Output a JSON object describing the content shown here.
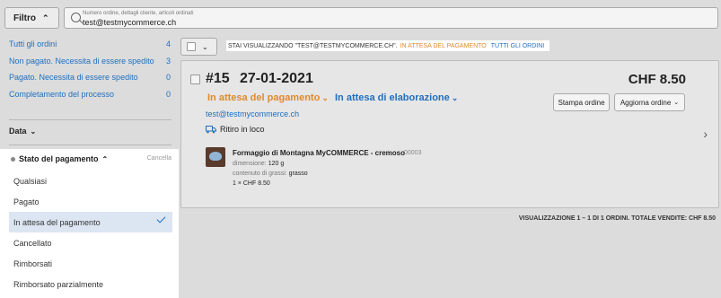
{
  "toolbar": {
    "filter_label": "Filtro"
  },
  "search": {
    "placeholder": "Numero ordine, dettagli cliente, articoli ordinati",
    "value": "test@testmycommerce.ch"
  },
  "sidebar": {
    "items": [
      {
        "label": "Tutti gli ordini",
        "count": "4"
      },
      {
        "label": "Non pagato. Necessita di essere spedito",
        "count": "3"
      },
      {
        "label": "Pagato. Necessita di essere spedito",
        "count": "0"
      },
      {
        "label": "Completamento del processo",
        "count": "0"
      }
    ],
    "data_label": "Data",
    "payment": {
      "title": "Stato del pagamento",
      "cancel": "Cancella",
      "options": [
        "Qualsiasi",
        "Pagato",
        "In attesa del pagamento",
        "Cancellato",
        "Rimborsati",
        "Rimborsato parzialmente"
      ],
      "selected": "In attesa del pagamento"
    }
  },
  "info": {
    "prefix": "STAI VISUALIZZANDO \"TEST@TESTMYCOMMERCE.CH\".",
    "status": "IN ATTESA DEL PAGAMENTO",
    "all_link": "TUTTI GLI ORDINI"
  },
  "order": {
    "number": "#15",
    "date": "27-01-2021",
    "total": "CHF 8.50",
    "payment_status": "In attesa del pagamento",
    "fulfillment_status": "In attesa di elaborazione",
    "email": "test@testmycommerce.ch",
    "shipping": "Ritiro in loco",
    "print_label": "Stampa ordine",
    "update_label": "Aggiorna ordine",
    "item": {
      "name": "Formaggio di Montagna MyCOMMERCE - cremoso",
      "sku": "00003",
      "dim_key": "dimensione:",
      "dim_val": "120 g",
      "fat_key": "contenuto di grassi:",
      "fat_val": "grasso",
      "qty_price": "1 × CHF 8.50"
    }
  },
  "footer": "VISUALIZZAZIONE 1 – 1 DI 1 ORDINI. TOTALE VENDITE: CHF 8.50",
  "colors": {
    "accent": "#1f6fc0",
    "pending": "#e08a2c",
    "selected_bg": "#dce6f2"
  }
}
